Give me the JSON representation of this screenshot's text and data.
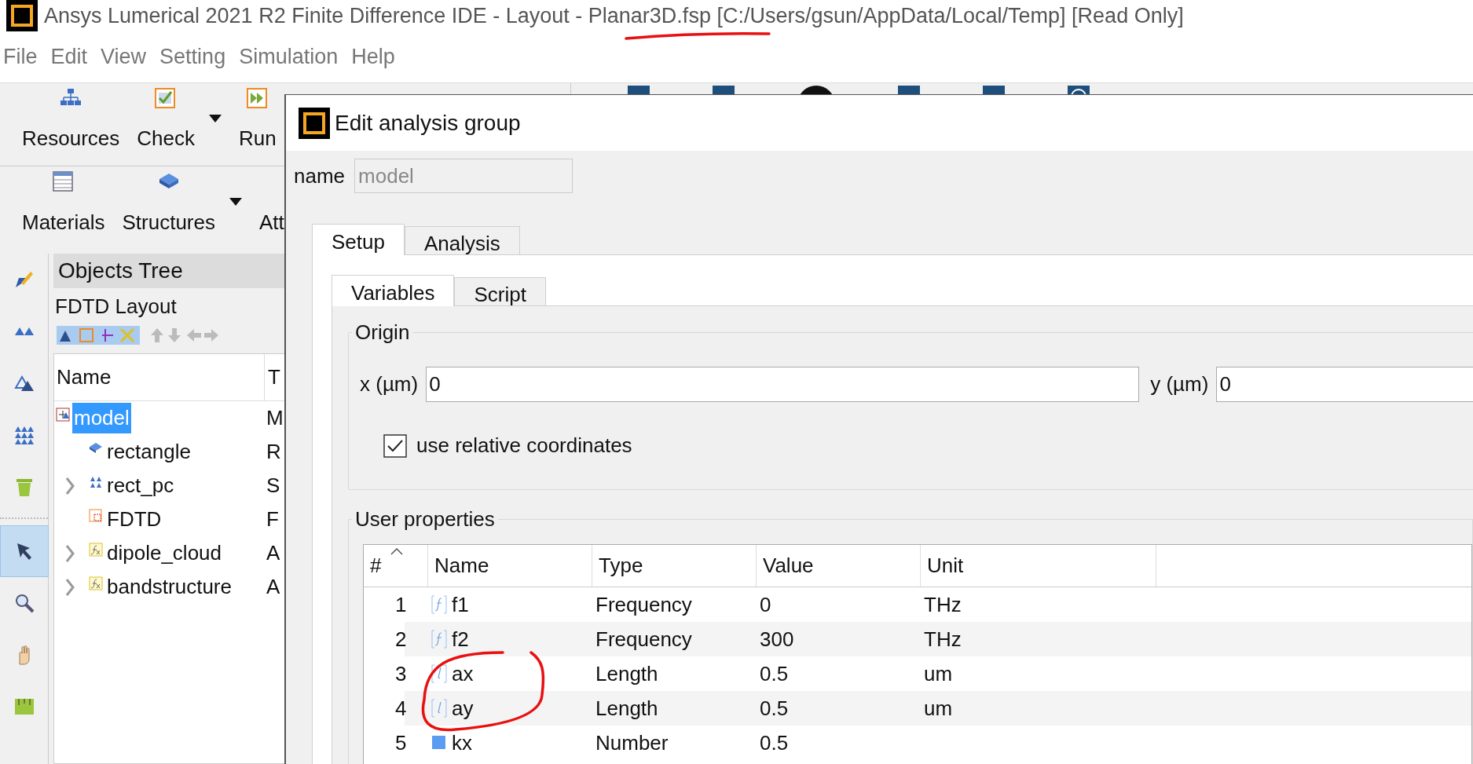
{
  "window": {
    "title": "Ansys Lumerical 2021 R2 Finite Difference IDE - Layout - Planar3D.fsp [C:/Users/gsun/AppData/Local/Temp] [Read Only]"
  },
  "menu": [
    "File",
    "Edit",
    "View",
    "Setting",
    "Simulation",
    "Help"
  ],
  "toolbar_rows": [
    [
      {
        "label": "Resources",
        "kind": "network",
        "dropdown": false
      },
      {
        "label": "Check",
        "kind": "check",
        "dropdown": true
      },
      {
        "label": "Run",
        "kind": "run",
        "dropdown": false
      }
    ],
    [
      {
        "label": "Materials",
        "kind": "table",
        "dropdown": false
      },
      {
        "label": "Structures",
        "kind": "slab",
        "dropdown": true
      },
      {
        "label": "Att",
        "dropdown": false
      }
    ]
  ],
  "launcher_icons": [
    {
      "kind": "square"
    },
    {
      "kind": "square"
    },
    {
      "kind": "circle"
    },
    {
      "kind": "square"
    },
    {
      "kind": "square"
    },
    {
      "kind": "chat"
    }
  ],
  "side_tools": [
    {
      "kind": "pencil",
      "selected": false
    },
    {
      "kind": "pair",
      "selected": false
    },
    {
      "kind": "outline",
      "selected": false
    },
    {
      "kind": "array",
      "selected": false
    },
    {
      "kind": "trash",
      "selected": false
    },
    {
      "kind": "pointer",
      "selected": true
    },
    {
      "kind": "zoom",
      "selected": false
    },
    {
      "kind": "hand",
      "selected": false
    },
    {
      "kind": "ruler",
      "selected": false
    }
  ],
  "objects_tree": {
    "title": "Objects Tree",
    "subtitle": "FDTD Layout",
    "columns": [
      "Name",
      "T"
    ],
    "items": [
      {
        "name": "model",
        "column_2": "M",
        "kind": "group",
        "selected": true,
        "children": [
          {
            "name": "rectangle",
            "column_2": "R",
            "kind": "slab",
            "selected": false
          },
          {
            "name": "rect_pc",
            "column_2": "S",
            "kind": "array",
            "selected": false,
            "expanded": false
          },
          {
            "name": "FDTD",
            "column_2": "F",
            "kind": "fdtd",
            "selected": false
          },
          {
            "name": "dipole_cloud",
            "column_2": "A",
            "kind": "fx",
            "selected": false,
            "expanded": false
          },
          {
            "name": "bandstructure",
            "column_2": "A",
            "kind": "fx",
            "selected": false,
            "expanded": false
          }
        ]
      }
    ]
  },
  "dialog": {
    "title": "Edit analysis group",
    "name_label": "name",
    "name_value": "model",
    "name_disabled": true,
    "tabs": [
      {
        "label": "Setup",
        "selected": true
      },
      {
        "label": "Analysis",
        "selected": false
      }
    ],
    "subtabs": [
      {
        "label": "Variables",
        "selected": true
      },
      {
        "label": "Script",
        "selected": false
      }
    ],
    "origin": {
      "title": "Origin",
      "x_label": "x (µm)",
      "x_value": "0",
      "y_label": "y (µm)",
      "y_value": "0",
      "relative_label": "use relative coordinates",
      "relative_checked": true
    },
    "user_properties": {
      "title": "User properties",
      "columns": [
        "#",
        "Name",
        "Type",
        "Value",
        "Unit"
      ],
      "rows": [
        {
          "index": "1",
          "kind": "frequency",
          "name": "f1",
          "type": "Frequency",
          "value": "0",
          "unit": "THz"
        },
        {
          "index": "2",
          "kind": "frequency",
          "name": "f2",
          "type": "Frequency",
          "value": "300",
          "unit": "THz"
        },
        {
          "index": "3",
          "kind": "length",
          "name": "ax",
          "type": "Length",
          "value": "0.5",
          "unit": "um"
        },
        {
          "index": "4",
          "kind": "length",
          "name": "ay",
          "type": "Length",
          "value": "0.5",
          "unit": "um"
        },
        {
          "index": "5",
          "kind": "number",
          "name": "kx",
          "type": "Number",
          "value": "0.5"
        }
      ]
    }
  },
  "annotations": [
    {
      "kind": "underline"
    },
    {
      "kind": "circle"
    }
  ]
}
